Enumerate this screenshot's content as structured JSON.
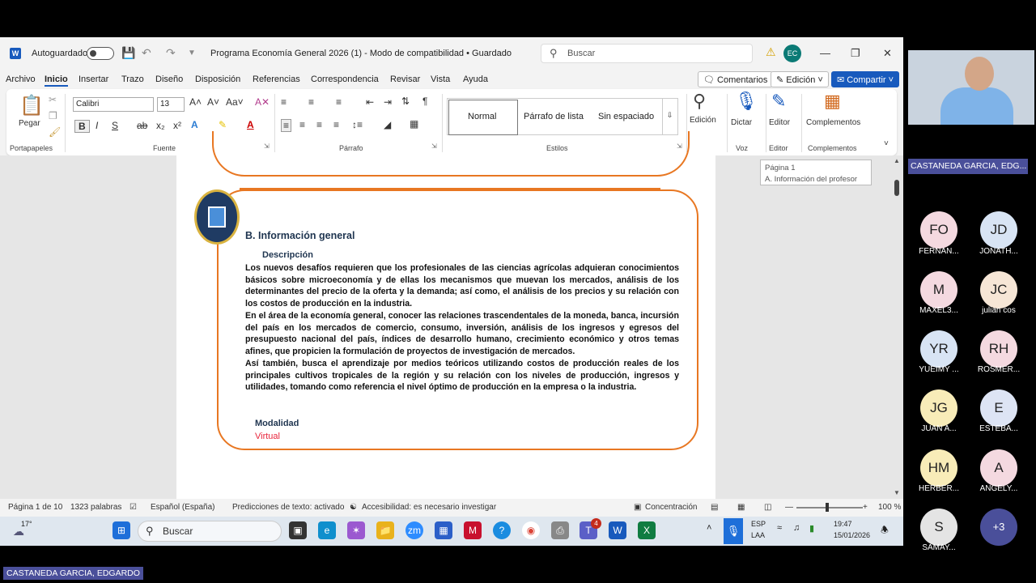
{
  "titlebar": {
    "autosave_label": "Autoguardado",
    "document_title": "Programa Economía General 2026 (1)  -  Modo de compatibilidad  •  Guardado",
    "search_placeholder": "Buscar",
    "user_initials": "EC"
  },
  "menu": {
    "tabs": [
      "Archivo",
      "Inicio",
      "Insertar",
      "Trazo",
      "Diseño",
      "Disposición",
      "Referencias",
      "Correspondencia",
      "Revisar",
      "Vista",
      "Ayuda"
    ],
    "active_tab": "Inicio",
    "comments_label": "Comentarios",
    "editing_label": "Edición",
    "share_label": "Compartir"
  },
  "ribbon": {
    "paste_label": "Pegar",
    "font_name": "Calibri",
    "font_size": "13",
    "styles": [
      "Normal",
      "Párrafo de lista",
      "Sin espaciado"
    ],
    "editing_label": "Edición",
    "dictate_label": "Dictar",
    "editor_label": "Editor",
    "addins_label": "Complementos",
    "group_labels": {
      "clipboard": "Portapapeles",
      "font": "Fuente",
      "paragraph": "Párrafo",
      "styles": "Estilos",
      "voice": "Voz",
      "editor": "Editor",
      "addins": "Complementos"
    }
  },
  "tooltip": {
    "line1": "Página 1",
    "line2": "A. Información del profesor"
  },
  "document": {
    "section_heading": "B.  Información general",
    "sub_heading": "Descripción",
    "paragraph1": "Los nuevos desafíos requieren que los profesionales de las ciencias agrícolas adquieran conocimientos básicos sobre microeconomía y de ellas los mecanismos que muevan los mercados, análisis de los determinantes del precio de la oferta y la demanda; así como, el análisis de los precios y su relación con los costos de producción en la industria.",
    "paragraph2": "En el área de la economía general, conocer las relaciones trascendentales de la moneda, banca, incursión del país en los mercados de comercio, consumo, inversión, análisis de los ingresos y egresos del presupuesto nacional del país, índices de desarrollo humano, crecimiento económico y otros temas afines, que propicien la formulación de proyectos de investigación de mercados.",
    "paragraph3": "Así también, busca el aprendizaje por medios teóricos utilizando costos de producción reales de los principales cultivos tropicales de la región y su relación con los niveles de producción, ingresos y utilidades, tomando como referencia el nivel óptimo de producción en la empresa o la industria.",
    "modality_label": "Modalidad",
    "modality_value": "Virtual"
  },
  "statusbar": {
    "page": "Página 1 de 10",
    "words": "1323 palabras",
    "language": "Español (España)",
    "predictions": "Predicciones de texto: activado",
    "accessibility": "Accesibilidad: es necesario investigar",
    "focus": "Concentración",
    "zoom": "100 %"
  },
  "taskbar": {
    "weather": "17°",
    "search_placeholder": "Buscar",
    "teams_badge": "4",
    "lang_line1": "ESP",
    "lang_line2": "LAA",
    "time": "19:47",
    "date": "15/01/2026"
  },
  "meeting": {
    "presenter_name": "CASTANEDA GARCIA, EDG...",
    "bottom_name": "CASTANEDA GARCIA, EDGARDO",
    "participants": [
      {
        "initials": "FO",
        "name": "FERNAN...",
        "color": "#f4d9e0"
      },
      {
        "initials": "JD",
        "name": "JONATH...",
        "color": "#d8e4f4"
      },
      {
        "initials": "M",
        "name": "MAXEL3...",
        "color": "#f4d9e0"
      },
      {
        "initials": "JC",
        "name": "julian cos",
        "color": "#f6e6d6"
      },
      {
        "initials": "YR",
        "name": "YUEIMY ...",
        "color": "#d8e4f4"
      },
      {
        "initials": "RH",
        "name": "ROSMER...",
        "color": "#f4d9e0"
      },
      {
        "initials": "JG",
        "name": "JUAN A...",
        "color": "#f8ecb8"
      },
      {
        "initials": "E",
        "name": "ESTEBA...",
        "color": "#dde4f4"
      },
      {
        "initials": "HM",
        "name": "HERBER...",
        "color": "#f8ecb8"
      },
      {
        "initials": "A",
        "name": "ANGELY...",
        "color": "#f4d9e0"
      },
      {
        "initials": "S",
        "name": "SAMAY...",
        "color": "#e4e4e4"
      }
    ],
    "more_count": "+3"
  }
}
